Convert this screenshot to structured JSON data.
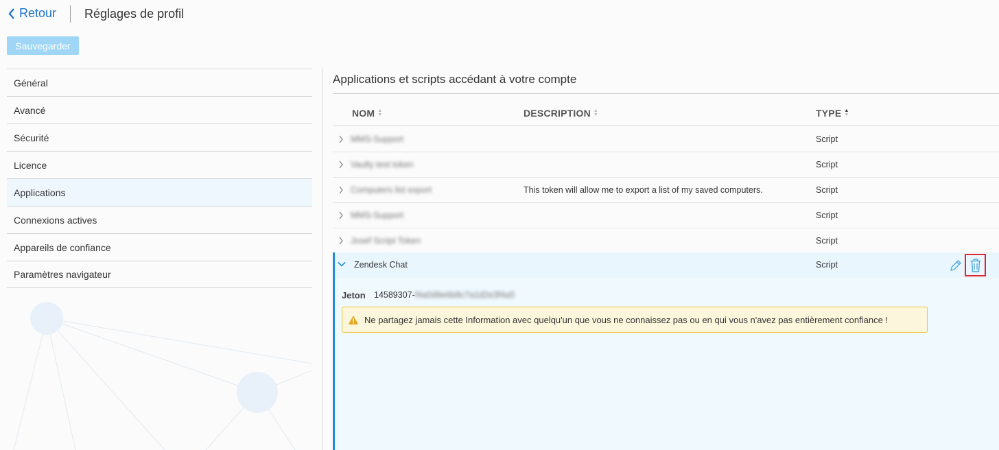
{
  "header": {
    "back_label": "Retour",
    "title": "Réglages de profil",
    "save_label": "Sauvegarder"
  },
  "sidebar": {
    "items": [
      {
        "label": "Général"
      },
      {
        "label": "Avancé"
      },
      {
        "label": "Sécurité"
      },
      {
        "label": "Licence"
      },
      {
        "label": "Applications",
        "active": true
      },
      {
        "label": "Connexions actives"
      },
      {
        "label": "Appareils de confiance"
      },
      {
        "label": "Paramètres navigateur"
      }
    ]
  },
  "main": {
    "section_title": "Applications et scripts accédant à votre compte",
    "columns": {
      "name": "NOM",
      "description": "DESCRIPTION",
      "type": "TYPE"
    },
    "sort": {
      "column": "type",
      "direction": "ascending"
    },
    "rows": [
      {
        "name": "MMS-Support",
        "description": "",
        "type": "Script",
        "name_blurred": true
      },
      {
        "name": "Vaulty test token",
        "description": "",
        "type": "Script",
        "name_blurred": true
      },
      {
        "name": "Computers list export",
        "description": "This token will allow me to export a list of my saved computers.",
        "type": "Script",
        "name_blurred": true
      },
      {
        "name": "MMS-Support",
        "description": "",
        "type": "Script",
        "name_blurred": true
      },
      {
        "name": "Josef Script Token",
        "description": "",
        "type": "Script",
        "name_blurred": true
      },
      {
        "name": "Zendesk Chat",
        "description": "",
        "type": "Script",
        "expanded": true
      }
    ],
    "expanded": {
      "token_label": "Jeton",
      "token_prefix": "14589307-",
      "token_hidden": "f4a0d9e6b8c7a1d2e3f4a5",
      "warning": "Ne partagez jamais cette Information avec quelqu'un que vous ne connaissez pas ou en qui vous n'avez pas entièrement confiance !"
    }
  },
  "icons": {
    "back": "chevron-left-icon",
    "row_collapsed": "chevron-right-icon",
    "row_expanded": "chevron-down-icon",
    "edit": "pencil-icon",
    "delete": "trash-icon",
    "warning": "warning-triangle-icon"
  },
  "colors": {
    "accent": "#1e8fd3",
    "link": "#1a73c7",
    "save_button": "#9fd6f5",
    "highlight": "#e0282e",
    "warning_border": "#f0c330",
    "warning_bg": "#fcf6dc"
  }
}
